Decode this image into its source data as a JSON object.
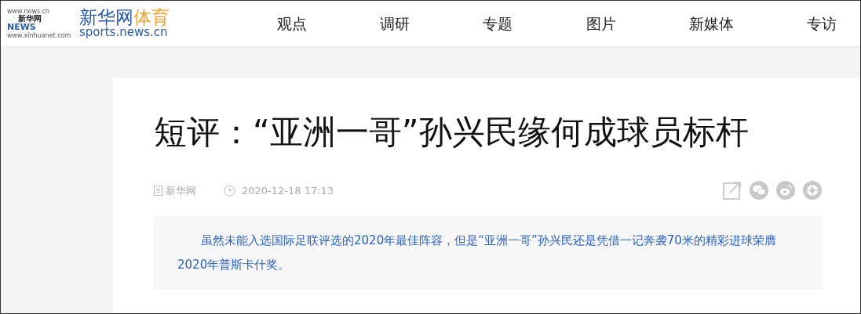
{
  "logo": {
    "mark_top": "www.news.cn",
    "mark_name": "新华网",
    "mark_news": "NEWS",
    "mark_bottom": "www.xinhuanet.com",
    "name": "新华网",
    "channel": "体育",
    "domain": "sports.news.cn"
  },
  "nav": [
    "观点",
    "调研",
    "专题",
    "图片",
    "新媒体",
    "专访"
  ],
  "article": {
    "title": "短评：“亚洲一哥”孙兴民缘何成球员标杆",
    "source": "新华网",
    "time": "2020-12-18 17:13",
    "share": [
      {
        "kind": "external"
      },
      {
        "kind": "wechat"
      },
      {
        "kind": "weibo"
      },
      {
        "kind": "moments"
      }
    ],
    "summary": "虽然未能入选国际足联评选的2020年最佳阵容，但是“亚洲一哥”孙兴民还是凭借一记奔袭70米的精彩进球荣膺2020年普斯卡什奖。"
  }
}
